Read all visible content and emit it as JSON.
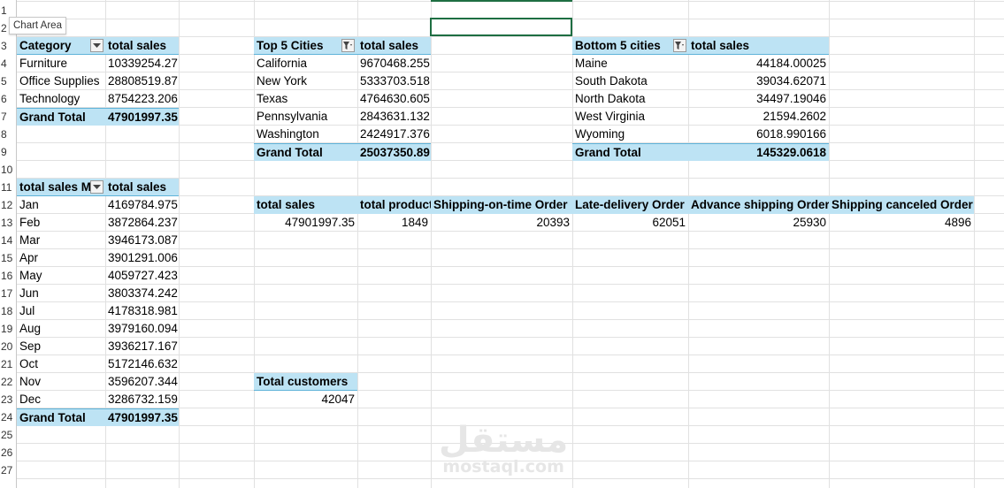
{
  "chart_area_tooltip": "Chart Area",
  "row_numbers": [
    "1",
    "2",
    "3",
    "4",
    "5",
    "6",
    "7",
    "8",
    "9",
    "10",
    "11",
    "12",
    "13",
    "14",
    "15",
    "16",
    "17",
    "18",
    "19",
    "20",
    "21",
    "22",
    "23",
    "24",
    "25",
    "26",
    "27"
  ],
  "category_table": {
    "header": [
      "Category",
      "total sales"
    ],
    "rows": [
      [
        "Furniture",
        "10339254.27"
      ],
      [
        "Office Supplies",
        "28808519.87"
      ],
      [
        "Technology",
        "8754223.206"
      ]
    ],
    "total": [
      "Grand Total",
      "47901997.35"
    ]
  },
  "top_cities_table": {
    "header": [
      "Top 5 Cities",
      "total sales"
    ],
    "rows": [
      [
        "California",
        "9670468.255"
      ],
      [
        "New York",
        "5333703.518"
      ],
      [
        "Texas",
        "4764630.605"
      ],
      [
        "Pennsylvania",
        "2843631.132"
      ],
      [
        "Washington",
        "2424917.376"
      ]
    ],
    "total": [
      "Grand Total",
      "25037350.89"
    ]
  },
  "bottom_cities_table": {
    "header": [
      "Bottom 5 cities",
      "total sales"
    ],
    "rows": [
      [
        "Maine",
        "44184.00025"
      ],
      [
        "South Dakota",
        "39034.62071"
      ],
      [
        "North Dakota",
        "34497.19046"
      ],
      [
        "West Virginia",
        "21594.2602"
      ],
      [
        "Wyoming",
        "6018.990166"
      ]
    ],
    "total": [
      "Grand Total",
      "145329.0618"
    ]
  },
  "month_table": {
    "header": [
      "total sales M",
      "total sales"
    ],
    "rows": [
      [
        "Jan",
        "4169784.975"
      ],
      [
        "Feb",
        "3872864.237"
      ],
      [
        "Mar",
        "3946173.087"
      ],
      [
        "Apr",
        "3901291.006"
      ],
      [
        "May",
        "4059727.423"
      ],
      [
        "Jun",
        "3803374.242"
      ],
      [
        "Jul",
        "4178318.981"
      ],
      [
        "Aug",
        "3979160.094"
      ],
      [
        "Sep",
        "3936217.167"
      ],
      [
        "Oct",
        "5172146.632"
      ],
      [
        "Nov",
        "3596207.344"
      ],
      [
        "Dec",
        "3286732.159"
      ]
    ],
    "total": [
      "Grand Total",
      "47901997.35"
    ]
  },
  "kpi_table": {
    "headers": [
      "total sales",
      "total product",
      "Shipping-on-time Order",
      "Late-delivery Order",
      "Advance shipping Order",
      "Shipping canceled Order"
    ],
    "values": [
      "47901997.35",
      "1849",
      "20393",
      "62051",
      "25930",
      "4896"
    ]
  },
  "customers_table": {
    "header": "Total customers",
    "value": "42047"
  },
  "watermark": {
    "arabic": "مستقل",
    "latin": "mostaql.com"
  },
  "colors": {
    "pivot_header_bg": "#bde3f4",
    "selection_border": "#1e6e42",
    "gridline": "#e1e1e1"
  }
}
